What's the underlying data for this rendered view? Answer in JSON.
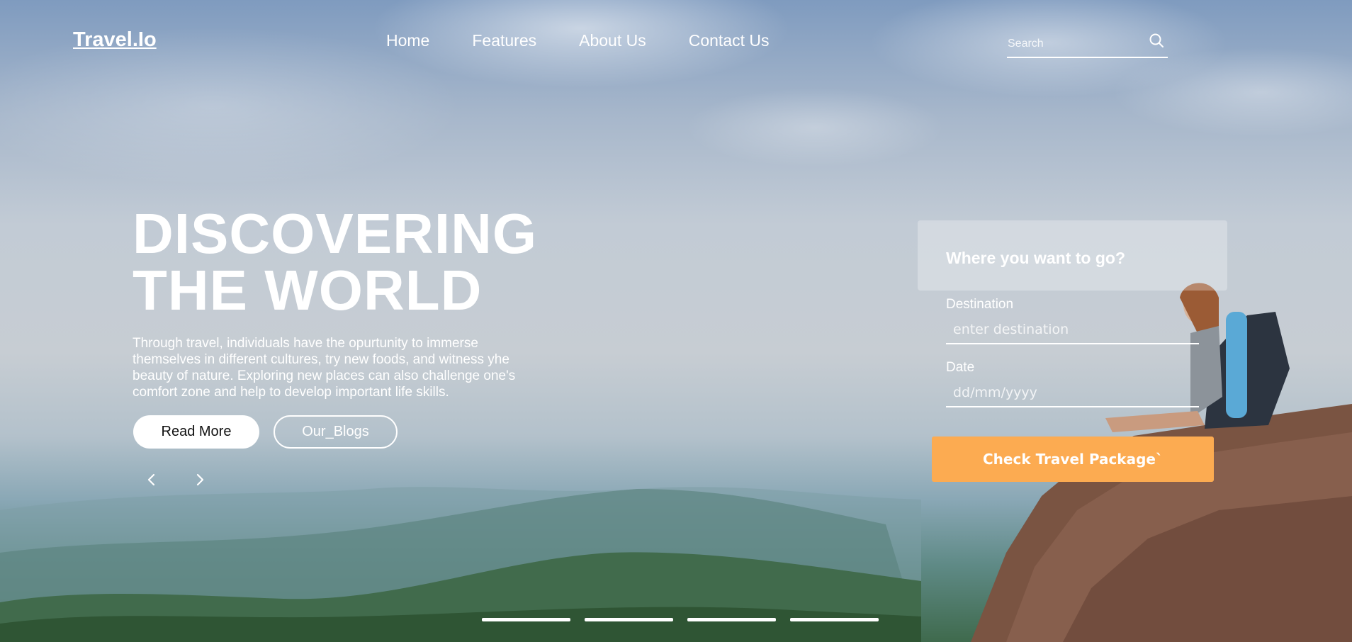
{
  "brand": {
    "logo": "Travel.Io"
  },
  "nav": {
    "items": [
      "Home",
      "Features",
      "About Us",
      "Contact Us"
    ]
  },
  "search": {
    "placeholder": "Search",
    "icon": "search-icon"
  },
  "hero": {
    "title_line1": "DISCOVERING",
    "title_line2": "THE WORLD",
    "description": "Through travel, individuals have the opurtunity to immerse themselves in different cultures, try new foods, and witness yhe beauty of nature. Exploring new places can also challenge one's comfort zone and help to develop important life skills.",
    "read_more_label": "Read More",
    "blogs_label": "Our_Blogs",
    "prev_icon": "chevron-left-icon",
    "next_icon": "chevron-right-icon"
  },
  "booking": {
    "heading": "Where you want to go?",
    "destination_label": "Destination",
    "destination_placeholder": "enter destination",
    "date_label": "Date",
    "date_placeholder": "dd/mm/yyyy",
    "submit_label": "Check Travel Package`"
  },
  "slides": {
    "count": 4
  },
  "colors": {
    "accent": "#fcab51",
    "text": "#ffffff"
  }
}
